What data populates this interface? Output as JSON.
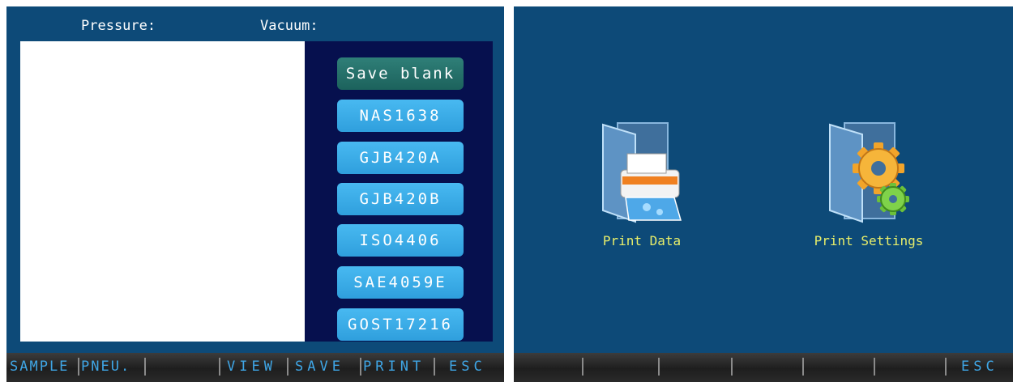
{
  "left_screen": {
    "header": {
      "pressure_label": "Pressure:",
      "vacuum_label": "Vacuum:"
    },
    "standards": [
      {
        "label": "Save blank",
        "active": true
      },
      {
        "label": "NAS1638",
        "active": false
      },
      {
        "label": "GJB420A",
        "active": false
      },
      {
        "label": "GJB420B",
        "active": false
      },
      {
        "label": "ISO4406",
        "active": false
      },
      {
        "label": "SAE4059E",
        "active": false
      },
      {
        "label": "GOST17216",
        "active": false
      }
    ],
    "softkeys": {
      "sample": "SAMPLE",
      "pneu": "PNEU.",
      "view": "VIEW",
      "save": "SAVE",
      "print": "PRINT",
      "esc": "ESC"
    }
  },
  "right_screen": {
    "menu": [
      {
        "label": "Print Data",
        "icon": "printer-folder-icon"
      },
      {
        "label": "Print Settings",
        "icon": "gears-folder-icon"
      }
    ],
    "softkeys": {
      "esc": "ESC"
    }
  },
  "colors": {
    "screen_bg": "#0d4a78",
    "panel_dark": "#06104e",
    "button_blue": "#3aaee8",
    "button_active": "#236e68",
    "softkey_text": "#3fa6e6",
    "menu_label": "#e8ee6a"
  }
}
